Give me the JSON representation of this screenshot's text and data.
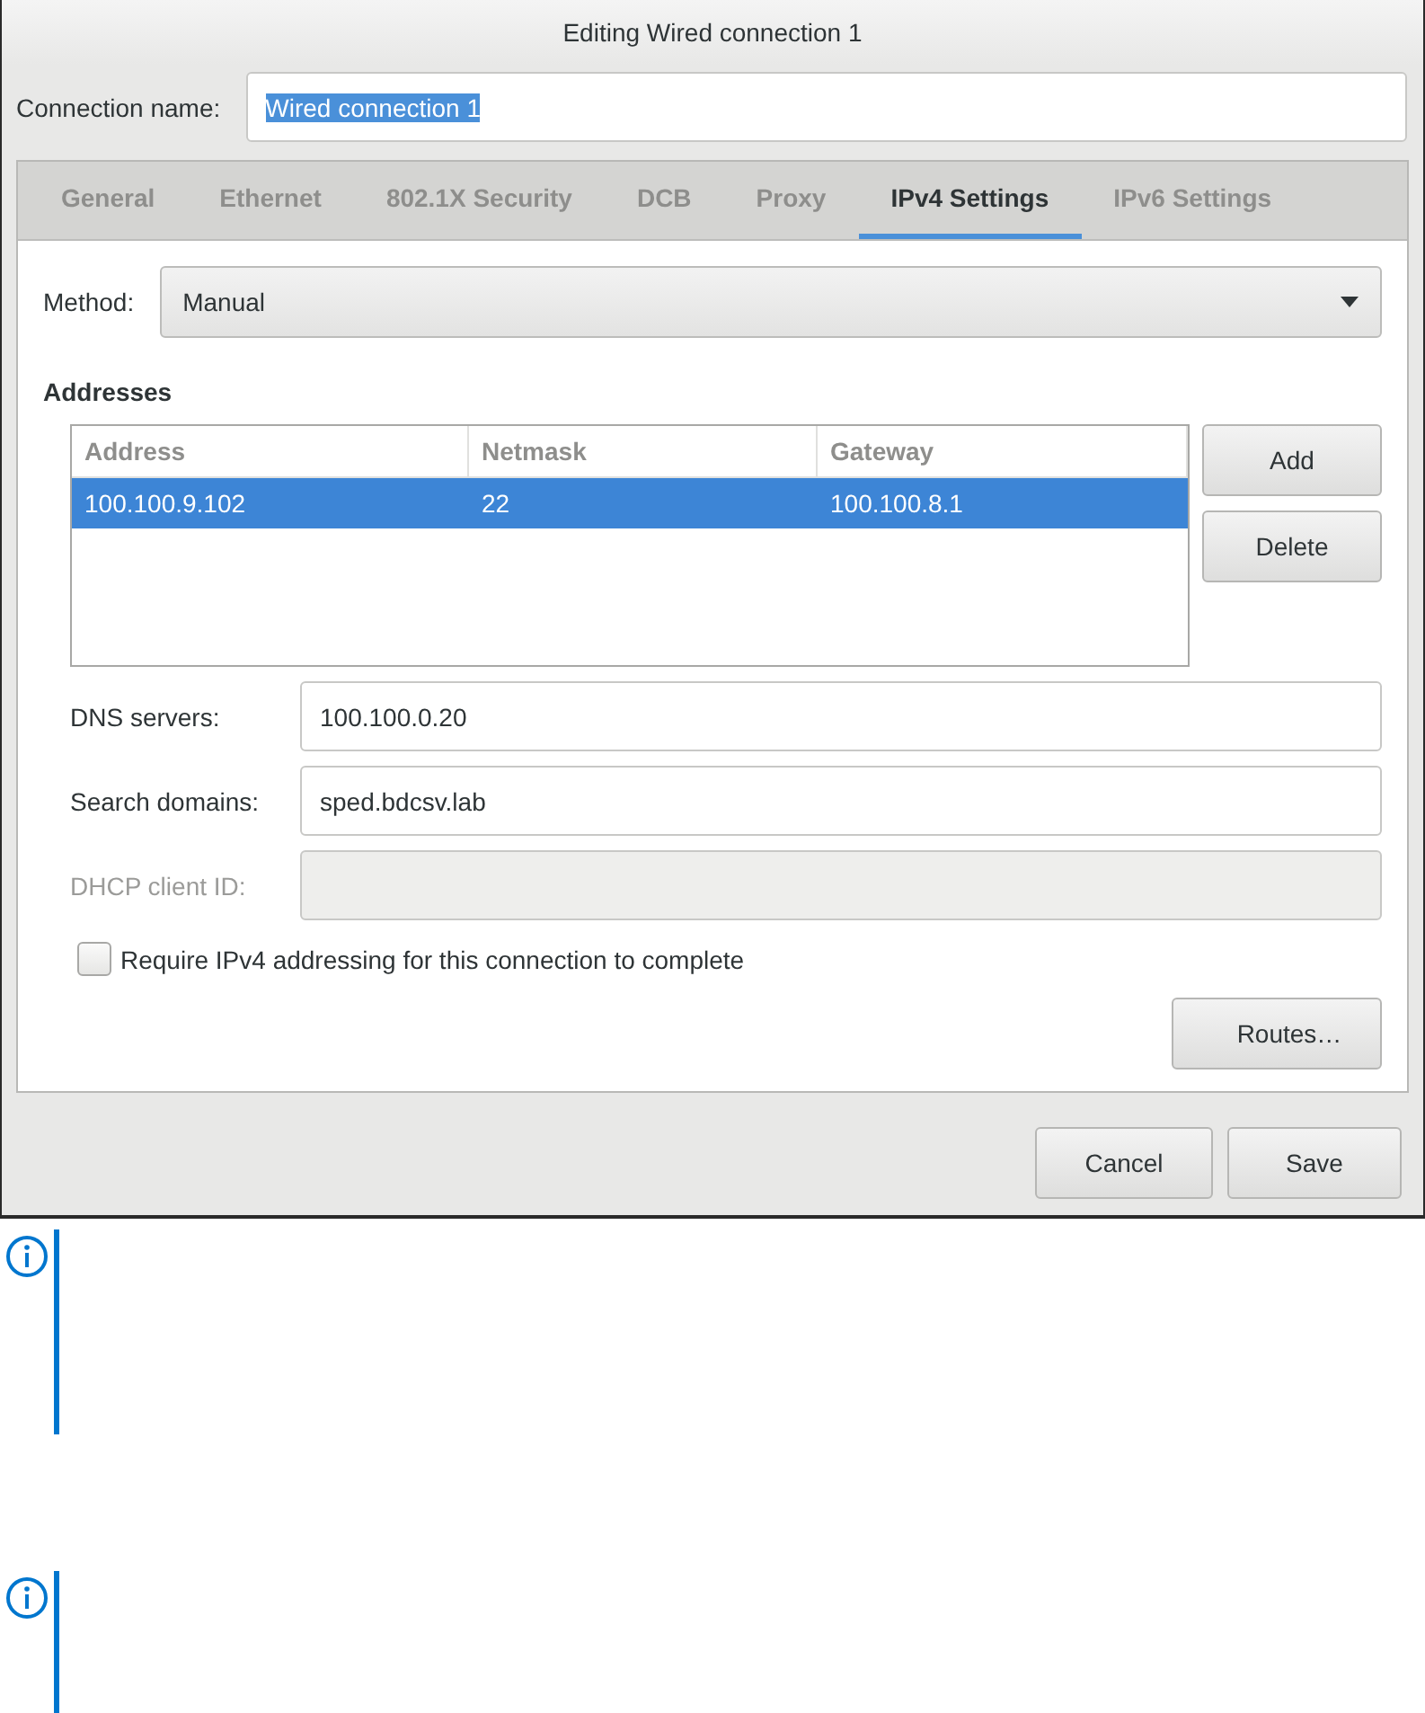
{
  "window": {
    "title": "Editing Wired connection 1"
  },
  "connection_name": {
    "label": "Connection name:",
    "value": "Wired connection 1",
    "text_selected": true
  },
  "tabs": [
    {
      "label": "General",
      "selected": false
    },
    {
      "label": "Ethernet",
      "selected": false
    },
    {
      "label": "802.1X Security",
      "selected": false
    },
    {
      "label": "DCB",
      "selected": false
    },
    {
      "label": "Proxy",
      "selected": false
    },
    {
      "label": "IPv4 Settings",
      "selected": true
    },
    {
      "label": "IPv6 Settings",
      "selected": false
    }
  ],
  "method": {
    "label": "Method:",
    "value": "Manual"
  },
  "addresses": {
    "heading": "Addresses",
    "columns": [
      "Address",
      "Netmask",
      "Gateway"
    ],
    "rows": [
      {
        "cells": [
          "100.100.9.102",
          "22",
          "100.100.8.1"
        ],
        "selected": true
      }
    ],
    "buttons": [
      "Add",
      "Delete"
    ]
  },
  "fields": [
    {
      "label": "DNS servers:",
      "value": "100.100.0.20",
      "disabled": false
    },
    {
      "label": "Search domains:",
      "value": "sped.bdcsv.lab",
      "disabled": false
    },
    {
      "label": "DHCP client ID:",
      "disabled": true
    }
  ],
  "require_checkbox": {
    "label": "Require IPv4 addressing for this connection to complete",
    "checked": false
  },
  "routes_button": "Routes…",
  "dialog_buttons": [
    "Cancel",
    "Save"
  ],
  "notes": [
    {
      "kind": "info"
    },
    {
      "kind": "info"
    }
  ]
}
